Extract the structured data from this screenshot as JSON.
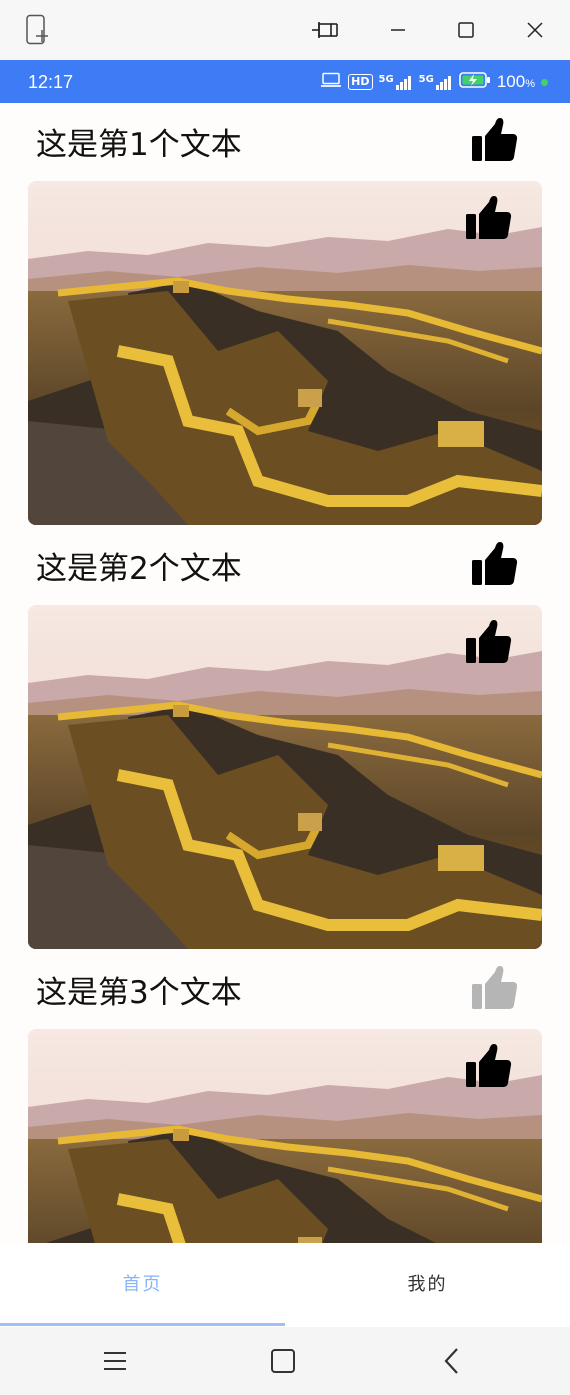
{
  "window": {
    "icons": [
      "new-window-icon",
      "pin-icon",
      "minimize-icon",
      "maximize-icon",
      "close-icon"
    ]
  },
  "status": {
    "time": "12:17",
    "hd_label": "HD",
    "net1": "5G",
    "net2": "5G",
    "battery": "100",
    "battery_unit": "%"
  },
  "colors": {
    "status_bar": "#3d7cf4",
    "tab_active": "#8ab4f8",
    "tab_inactive": "#333333",
    "like_active": "#000000",
    "like_inactive": "#b5b5b5"
  },
  "items": [
    {
      "title": "这是第1个文本",
      "liked": true
    },
    {
      "title": "这是第2个文本",
      "liked": true
    },
    {
      "title": "这是第3个文本",
      "liked": false
    }
  ],
  "tabs": [
    {
      "label": "首页",
      "active": true
    },
    {
      "label": "我的",
      "active": false
    }
  ],
  "nav": {
    "icons": [
      "menu-icon",
      "home-square-icon",
      "back-icon"
    ]
  }
}
